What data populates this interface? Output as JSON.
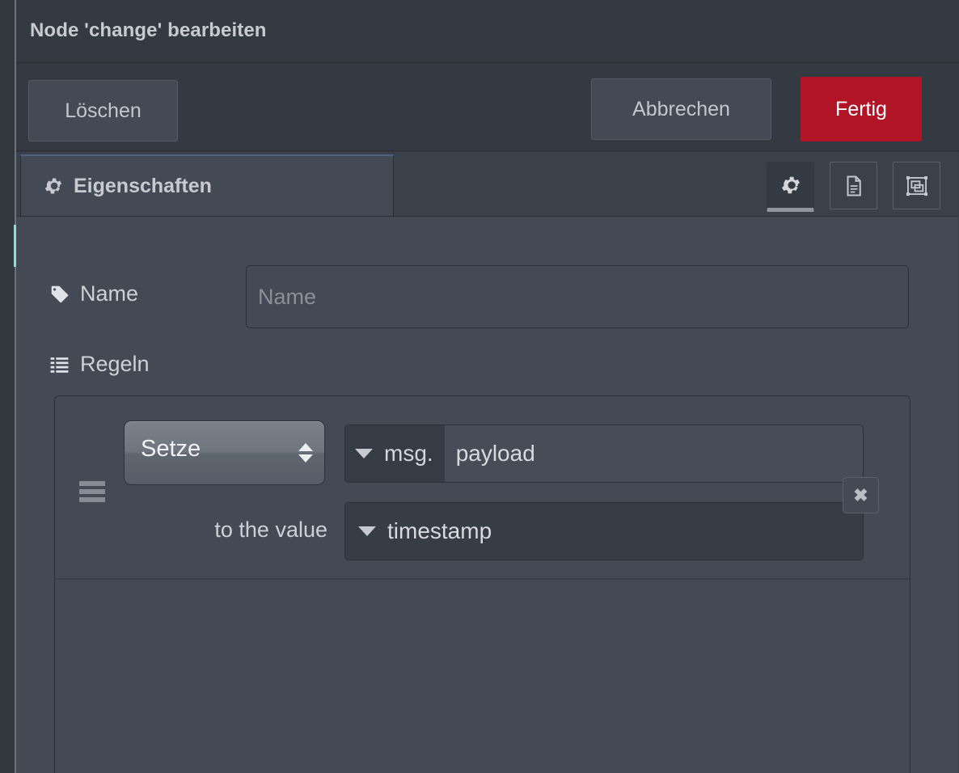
{
  "dialog": {
    "title": "Node 'change' bearbeiten"
  },
  "buttons": {
    "delete_label": "Löschen",
    "cancel_label": "Abbrechen",
    "done_label": "Fertig",
    "done_color": "#b01425"
  },
  "tabs": [
    {
      "label": "Eigenschaften",
      "icon": "gear-icon",
      "active": true
    }
  ],
  "icon_buttons": [
    {
      "name": "properties-tab-icon-button",
      "icon": "gear-icon",
      "active": true
    },
    {
      "name": "description-tab-icon-button",
      "icon": "document-icon",
      "active": false
    },
    {
      "name": "appearance-tab-icon-button",
      "icon": "appearance-icon",
      "active": false
    }
  ],
  "form": {
    "name_label": "Name",
    "name_icon": "tag-icon",
    "name_value": "",
    "name_placeholder": "Name",
    "rules_label": "Regeln",
    "rules_icon": "list-icon"
  },
  "rules": [
    {
      "action": "Setze",
      "property_prefix": "msg.",
      "property_value": "payload",
      "to_label": "to the value",
      "value_type": "timestamp",
      "remove_label": "✖"
    }
  ],
  "colors": {
    "panel_bg": "#434a56",
    "header_bg": "#343a42",
    "outer_bg": "#33383f",
    "accent_red": "#b01425",
    "port_indicator": "#9fd8d8",
    "text": "#cdd1d6"
  }
}
